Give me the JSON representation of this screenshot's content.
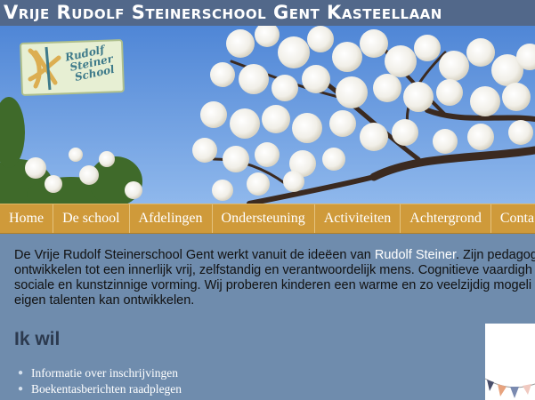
{
  "header": {
    "title": "Vrije Rudolf Steinerschool Gent Kasteellaan"
  },
  "banner": {
    "logo": {
      "lines": [
        "Rudolf",
        "Steiner",
        "School"
      ]
    },
    "image": "cherry-blossom-photo"
  },
  "nav": {
    "items": [
      "Home",
      "De school",
      "Afdelingen",
      "Ondersteuning",
      "Activiteiten",
      "Achtergrond",
      "Conta"
    ]
  },
  "intro": {
    "line1_before": "De Vrije Rudolf Steinerschool Gent werkt vanuit de ideëen van ",
    "link": "Rudolf Steiner",
    "line1_after": ". Zijn pedagog",
    "line2": "ontwikkelen tot een innerlijk vrij, zelfstandig en verantwoordelijk mens. Cognitieve vaardigh",
    "line3": "sociale en kunstzinnige vorming. Wij proberen kinderen een warme en zo veelzijdig mogeli",
    "line4": "eigen talenten kan ontwikkelen."
  },
  "section": {
    "heading": "Ik wil"
  },
  "links": [
    "Informatie over inschrijvingen",
    "Boekentasberichten raadplegen"
  ],
  "colors": {
    "header_bg": "#52688a",
    "nav_bg": "#cf9a3a",
    "page_bg": "#6f8cad",
    "sky": "#5f93de",
    "link": "#ffffff"
  }
}
